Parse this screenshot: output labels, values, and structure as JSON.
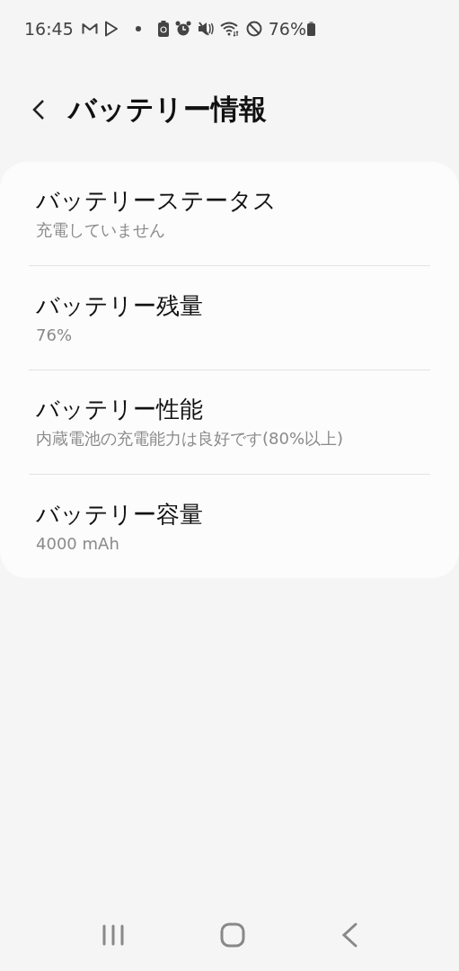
{
  "status_bar": {
    "time": "16:45",
    "battery": "76%"
  },
  "header": {
    "title": "バッテリー情報"
  },
  "items": [
    {
      "title": "バッテリーステータス",
      "value": "充電していません"
    },
    {
      "title": "バッテリー残量",
      "value": "76%"
    },
    {
      "title": "バッテリー性能",
      "value": "内蔵電池の充電能力は良好です(80%以上)"
    },
    {
      "title": "バッテリー容量",
      "value": "4000 mAh"
    }
  ]
}
